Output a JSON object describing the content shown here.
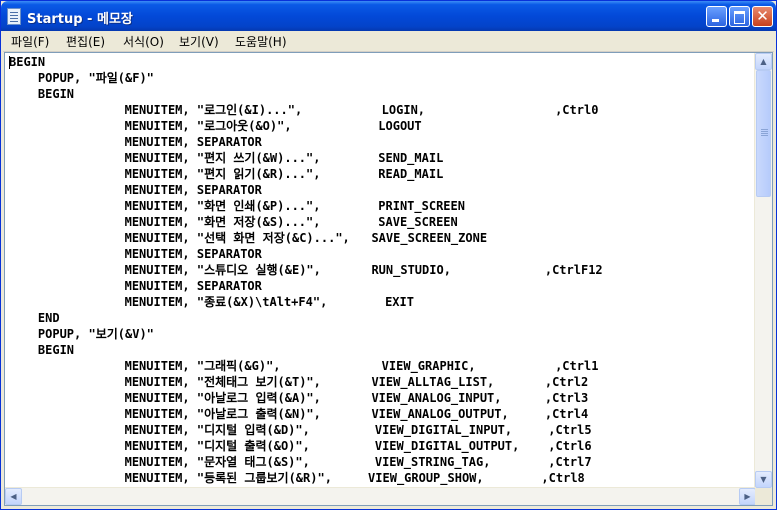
{
  "window": {
    "title": "Startup - 메모장",
    "minimize_label": "",
    "maximize_label": "",
    "close_label": "✕"
  },
  "menu": [
    "파일(F)",
    "편집(E)",
    "서식(O)",
    "보기(V)",
    "도움말(H)"
  ],
  "lines": [
    "BEGIN",
    "    POPUP, \"파일(&F)\"",
    "    BEGIN",
    "                MENUITEM, \"로그인(&I)...\",           LOGIN,                  ,Ctrl0",
    "                MENUITEM, \"로그아웃(&O)\",            LOGOUT",
    "                MENUITEM, SEPARATOR",
    "                MENUITEM, \"편지 쓰기(&W)...\",        SEND_MAIL",
    "                MENUITEM, \"편지 읽기(&R)...\",        READ_MAIL",
    "                MENUITEM, SEPARATOR",
    "                MENUITEM, \"화면 인쇄(&P)...\",        PRINT_SCREEN",
    "                MENUITEM, \"화면 저장(&S)...\",        SAVE_SCREEN",
    "                MENUITEM, \"선택 화면 저장(&C)...\",   SAVE_SCREEN_ZONE",
    "                MENUITEM, SEPARATOR",
    "                MENUITEM, \"스튜디오 실행(&E)\",       RUN_STUDIO,             ,CtrlF12",
    "                MENUITEM, SEPARATOR",
    "                MENUITEM, \"종료(&X)\\tAlt+F4\",        EXIT",
    "    END",
    "    POPUP, \"보기(&V)\"",
    "    BEGIN",
    "                MENUITEM, \"그래픽(&G)\",              VIEW_GRAPHIC,           ,Ctrl1",
    "                MENUITEM, \"전체태그 보기(&T)\",       VIEW_ALLTAG_LIST,       ,Ctrl2",
    "                MENUITEM, \"아날로그 입력(&A)\",       VIEW_ANALOG_INPUT,      ,Ctrl3",
    "                MENUITEM, \"아날로그 출력(&N)\",       VIEW_ANALOG_OUTPUT,     ,Ctrl4",
    "                MENUITEM, \"디지털 입력(&D)\",         VIEW_DIGITAL_INPUT,     ,Ctrl5",
    "                MENUITEM, \"디지털 출력(&O)\",         VIEW_DIGITAL_OUTPUT,    ,Ctrl6",
    "                MENUITEM, \"문자열 태그(&S)\",         VIEW_STRING_TAG,        ,Ctrl7",
    "                MENUITEM, \"등록된 그룹보기(&R)\",     VIEW_GROUP_SHOW,        ,Ctrl8"
  ],
  "scrollbar": {
    "up_glyph": "▲",
    "down_glyph": "▼",
    "left_glyph": "◀",
    "right_glyph": "▶"
  }
}
